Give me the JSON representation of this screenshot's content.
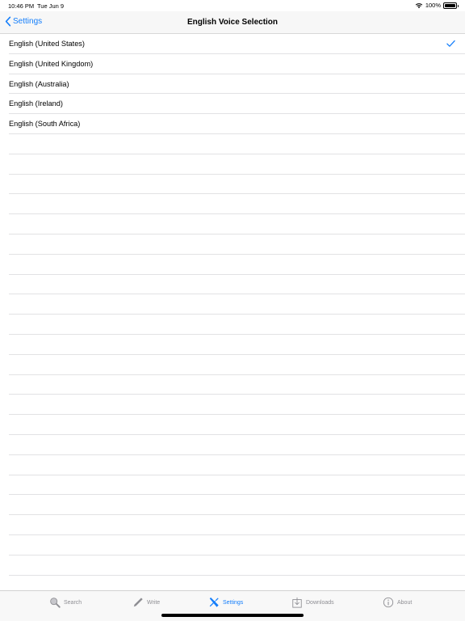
{
  "status_bar": {
    "time": "10:46 PM",
    "date": "Tue Jun 9",
    "battery": "100%"
  },
  "nav": {
    "back_label": "Settings",
    "title": "English Voice Selection"
  },
  "voices": [
    {
      "label": "English (United States)",
      "selected": true
    },
    {
      "label": "English (United Kingdom)",
      "selected": false
    },
    {
      "label": "English (Australia)",
      "selected": false
    },
    {
      "label": "English (Ireland)",
      "selected": false
    },
    {
      "label": "English (South Africa)",
      "selected": false
    }
  ],
  "tabs": {
    "search": "Search",
    "write": "Write",
    "settings": "Settings",
    "downloads": "Downloads",
    "about": "About"
  },
  "colors": {
    "accent": "#147efb",
    "inactive": "#8e8e93"
  }
}
